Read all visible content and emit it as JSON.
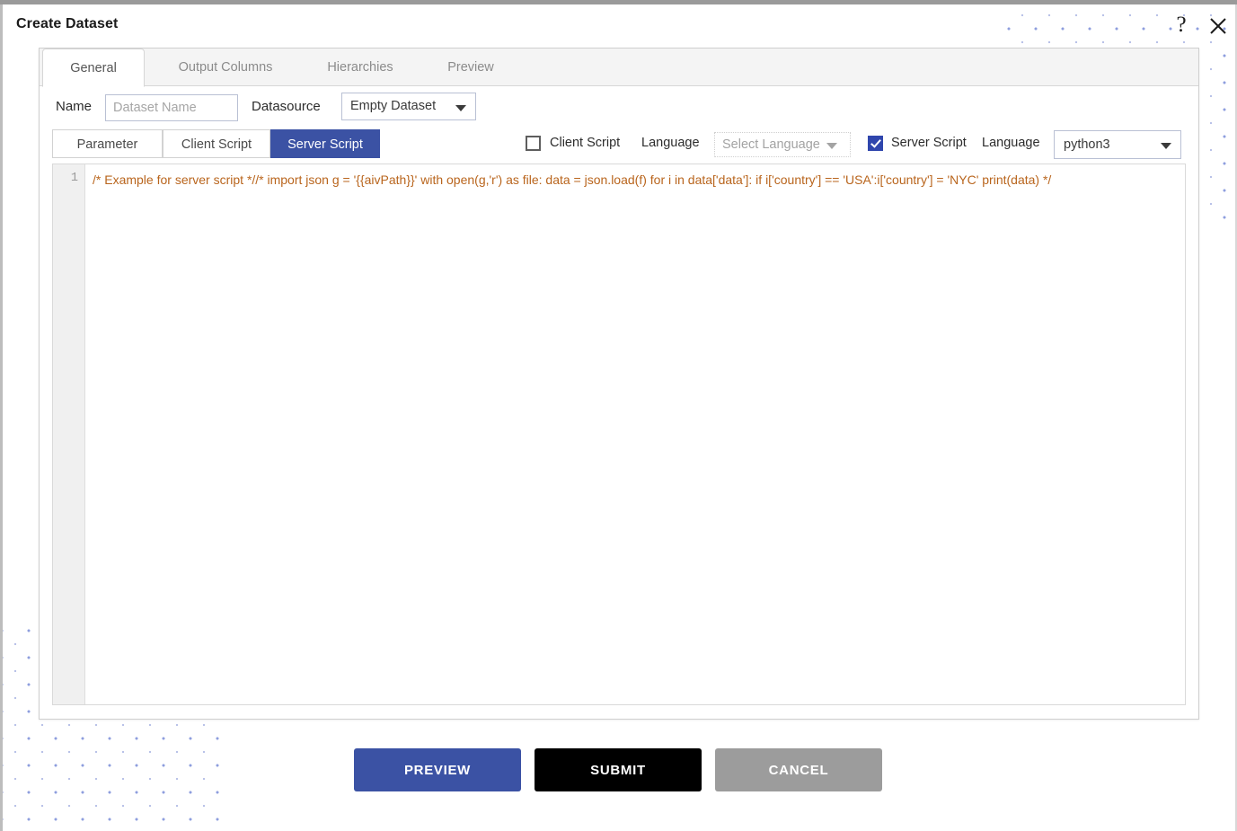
{
  "dialog": {
    "title": "Create Dataset",
    "help_icon": "question-mark-icon",
    "close_icon": "close-icon"
  },
  "tabs": [
    {
      "label": "General",
      "active": true
    },
    {
      "label": "Output Columns",
      "active": false
    },
    {
      "label": "Hierarchies",
      "active": false
    },
    {
      "label": "Preview",
      "active": false
    }
  ],
  "general": {
    "name_label": "Name",
    "name_value": "",
    "name_placeholder": "Dataset Name",
    "datasource_label": "Datasource",
    "datasource_value": "Empty Dataset"
  },
  "subtabs": [
    {
      "label": "Parameter",
      "active": false
    },
    {
      "label": "Client Script",
      "active": false
    },
    {
      "label": "Server Script",
      "active": true
    }
  ],
  "script_controls": {
    "client_script_label": "Client Script",
    "client_script_checked": false,
    "client_language_label": "Language",
    "client_language_value": "Select Language",
    "client_language_enabled": false,
    "server_script_label": "Server Script",
    "server_script_checked": true,
    "server_language_label": "Language",
    "server_language_value": "python3",
    "server_language_enabled": true
  },
  "editor": {
    "line_number": "1",
    "code": "/* Example for server script *//* import json g = '{{aivPath}}' with open(g,'r') as file: data = json.load(f) for i in data['data']: if i['country'] == 'USA':i['country'] = 'NYC' print(data) */"
  },
  "footer": {
    "preview_label": "PREVIEW",
    "submit_label": "SUBMIT",
    "cancel_label": "CANCEL"
  },
  "colors": {
    "accent_blue": "#3b52a4",
    "checkbox_blue": "#2f46ad",
    "submit_black": "#000000",
    "cancel_gray": "#9c9c9c",
    "code_orange": "#b9651d",
    "dot_pattern": "#8e9ede"
  }
}
